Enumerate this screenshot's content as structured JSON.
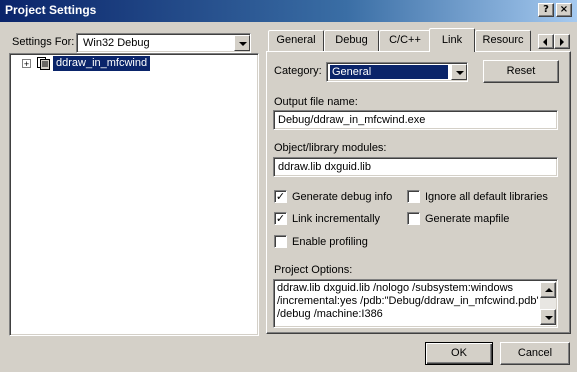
{
  "window": {
    "title": "Project Settings",
    "help_glyph": "?",
    "close_glyph": "×"
  },
  "left": {
    "settings_for_label": "Settings For:",
    "settings_for_value": "Win32 Debug",
    "tree": {
      "expand_glyph": "+",
      "item_label": "ddraw_in_mfcwind"
    }
  },
  "tabs": [
    {
      "label": "General"
    },
    {
      "label": "Debug"
    },
    {
      "label": "C/C++"
    },
    {
      "label": "Link"
    },
    {
      "label": "Resourc"
    }
  ],
  "active_tab": "Link",
  "link": {
    "category_label": "Category:",
    "category_value": "General",
    "reset_label": "Reset",
    "output_file_label": "Output file name:",
    "output_file_value": "Debug/ddraw_in_mfcwind.exe",
    "modules_label": "Object/library modules:",
    "modules_value": "ddraw.lib dxguid.lib",
    "checkboxes": [
      {
        "label": "Generate debug info",
        "checked": true
      },
      {
        "label": "Ignore all default libraries",
        "checked": false
      },
      {
        "label": "Link incrementally",
        "checked": true
      },
      {
        "label": "Generate mapfile",
        "checked": false
      },
      {
        "label": "Enable profiling",
        "checked": false
      }
    ],
    "check_glyph": "✓",
    "project_options_label": "Project Options:",
    "project_options_lines": [
      "ddraw.lib dxguid.lib /nologo /subsystem:windows",
      "/incremental:yes /pdb:\"Debug/ddraw_in_mfcwind.pdb\"",
      "/debug /machine:I386"
    ]
  },
  "footer": {
    "ok_label": "OK",
    "cancel_label": "Cancel"
  },
  "colors": {
    "face": "#d4d0c8",
    "title_active": "#0a246a",
    "selection": "#0a246a"
  }
}
